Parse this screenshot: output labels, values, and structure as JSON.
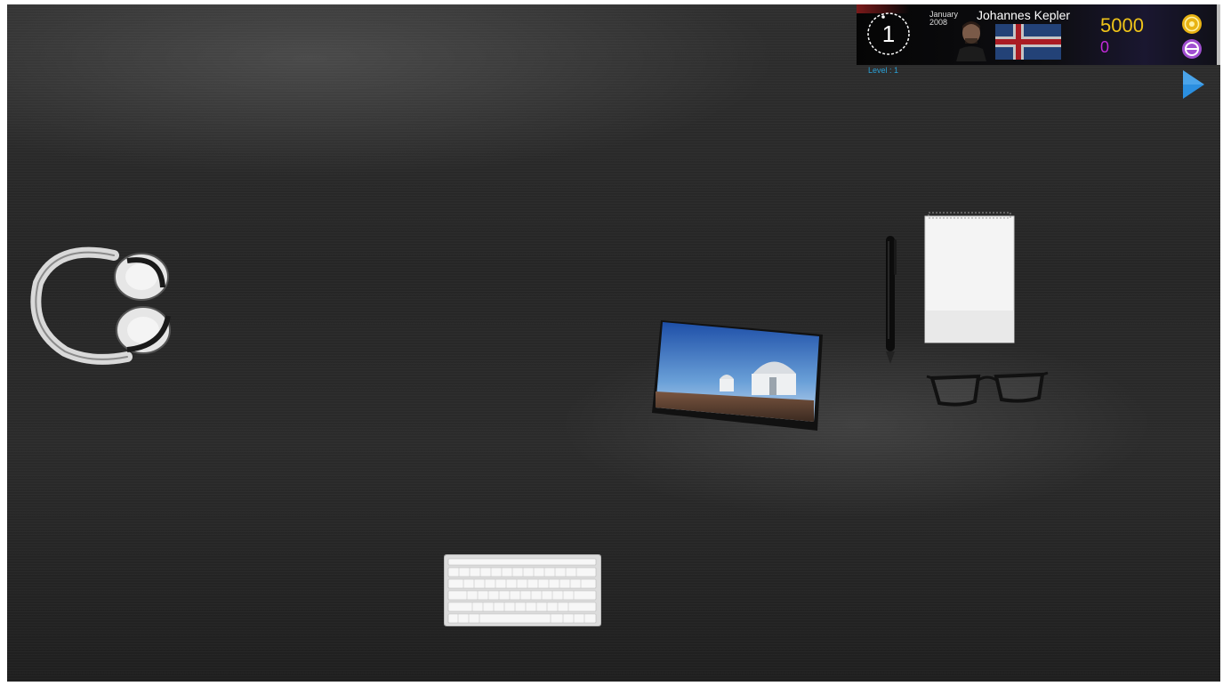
{
  "hud": {
    "turn": "1",
    "month": "January",
    "year": "2008",
    "player_name": "Johannes Kepler",
    "coins": "5000",
    "gems": "0",
    "level_label": "Level : 1",
    "icons": {
      "clock": "clock-icon",
      "portrait": "player-portrait",
      "flag": "iceland-flag",
      "coin": "coin-icon",
      "gem": "gem-icon",
      "next": "play-arrow-icon"
    }
  },
  "desk_items": [
    "headphones",
    "observatory-photo",
    "pen",
    "notepad",
    "glasses",
    "keyboard"
  ],
  "colors": {
    "coins": "#f0c419",
    "gems": "#c02ad6",
    "level": "#2aa0d6",
    "next_arrow": "#2b8fe0"
  }
}
